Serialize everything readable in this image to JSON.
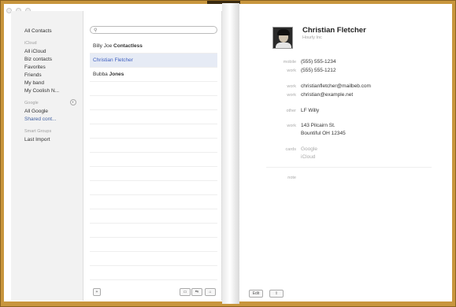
{
  "sidebar": {
    "all_contacts": "All Contacts",
    "icloud_header": "iCloud",
    "icloud_items": [
      "All iCloud",
      "Biz contacts",
      "Favorites",
      "Friends",
      "My band",
      "My Coolish N..."
    ],
    "google_header": "Google",
    "google_items": [
      "All Google",
      "Shared cont..."
    ],
    "smart_header": "Smart Groups",
    "smart_items": [
      "Last Import"
    ]
  },
  "list": {
    "search_placeholder": "",
    "contacts": [
      {
        "first": "Billy Joe",
        "last": "Contactless"
      },
      {
        "first": "Christian",
        "last": "Fletcher"
      },
      {
        "first": "Bubba",
        "last": "Jones"
      }
    ],
    "add_label": "+",
    "share_labels": [
      "▭",
      "⇆",
      "⌂"
    ]
  },
  "detail": {
    "name": "Christian Fletcher",
    "company": "Hourly Inc",
    "fields": [
      {
        "label": "mobile",
        "value": "(555) 555-1234"
      },
      {
        "label": "work",
        "value": "(555) 555-1212"
      },
      {
        "label": "work",
        "value": "christianfletcher@mailbeb.com"
      },
      {
        "label": "work",
        "value": "christian@example.net"
      },
      {
        "label": "other",
        "value": "LF Willy"
      },
      {
        "label": "work",
        "value": "143 Pilcairn St."
      },
      {
        "label": "",
        "value": "Bountiful OH 12345"
      },
      {
        "label": "cards",
        "value": "Google"
      },
      {
        "label": "",
        "value": "iCloud"
      },
      {
        "label": "note",
        "value": ""
      }
    ],
    "edit_label": "Edit",
    "share_label": "⇪"
  }
}
